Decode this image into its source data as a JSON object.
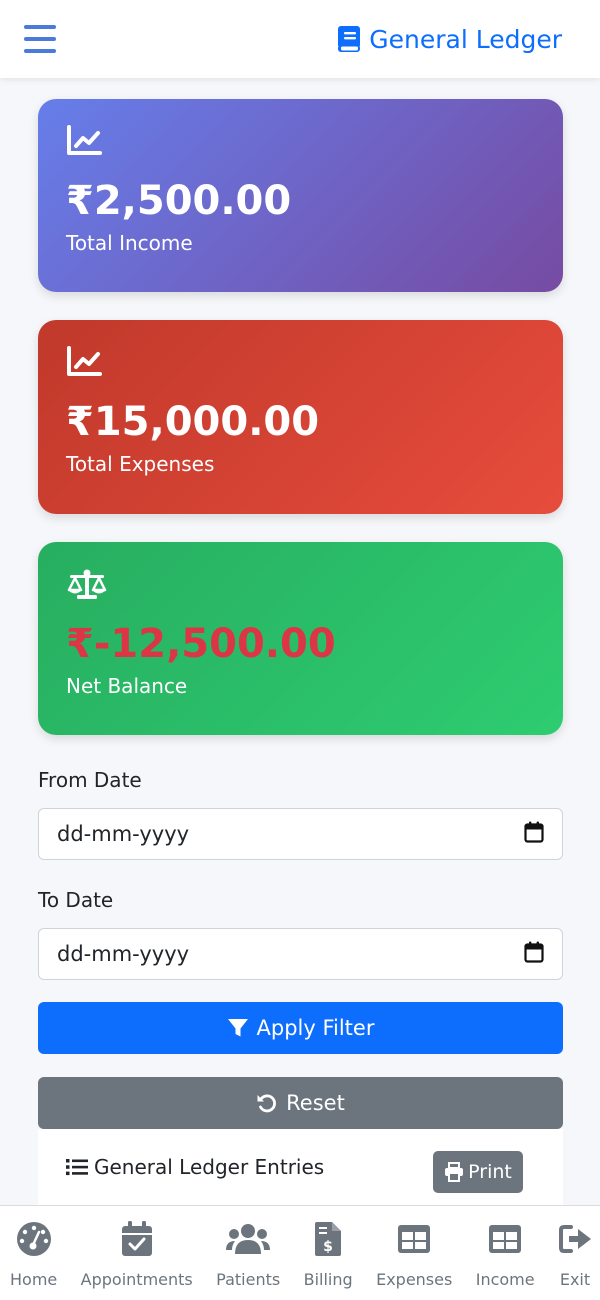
{
  "header": {
    "title": "General Ledger",
    "icon": "book-icon"
  },
  "cards": {
    "income": {
      "amount": "₹2,500.00",
      "label": "Total Income",
      "icon": "chart-line-icon"
    },
    "expenses": {
      "amount": "₹15,000.00",
      "label": "Total Expenses",
      "icon": "chart-line-icon"
    },
    "net": {
      "amount": "₹-12,500.00",
      "label": "Net Balance",
      "icon": "balance-scale-icon",
      "amount_color": "#dc3545"
    }
  },
  "filters": {
    "from_label": "From Date",
    "from_placeholder": "dd-mm-yyyy",
    "to_label": "To Date",
    "to_placeholder": "dd-mm-yyyy",
    "apply_label": "Apply Filter",
    "reset_label": "Reset"
  },
  "entries": {
    "title": "General Ledger Entries",
    "print_label": "Print"
  },
  "nav": [
    {
      "label": "Home",
      "icon": "dashboard-icon"
    },
    {
      "label": "Appointments",
      "icon": "calendar-check-icon"
    },
    {
      "label": "Patients",
      "icon": "users-icon"
    },
    {
      "label": "Billing",
      "icon": "invoice-dollar-icon"
    },
    {
      "label": "Expenses",
      "icon": "table-icon"
    },
    {
      "label": "Income",
      "icon": "table-icon"
    },
    {
      "label": "Exit",
      "icon": "sign-out-icon"
    }
  ],
  "colors": {
    "primary": "#0d6efd",
    "secondary": "#6c757d",
    "danger": "#dc3545"
  }
}
